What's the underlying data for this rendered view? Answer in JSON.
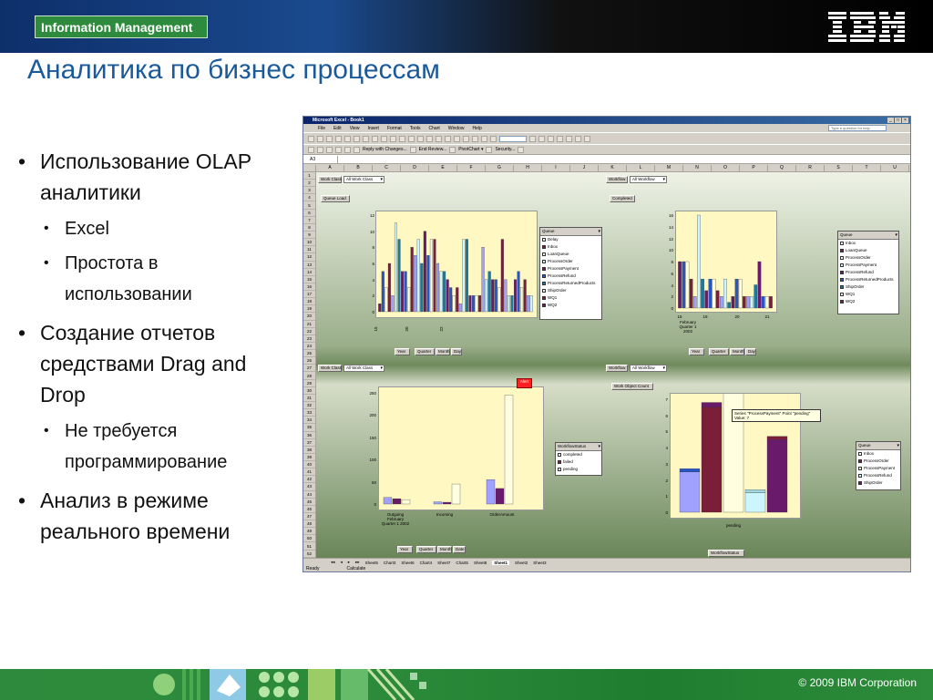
{
  "header": {
    "badge": "Information Management",
    "logo": "IBM",
    "title": "Аналитика по бизнес процессам"
  },
  "bullets": [
    {
      "text": "Использование OLAP аналитики",
      "sub": [
        "Excel",
        "Простота в использовании"
      ]
    },
    {
      "text": "Создание отчетов средствами Drag and Drop",
      "sub": [
        "Не требуется программирование"
      ]
    },
    {
      "text": "Анализ в режиме реального времени",
      "sub": []
    }
  ],
  "excel": {
    "window_title": "Microsoft Excel - Book1",
    "menu": [
      "File",
      "Edit",
      "View",
      "Insert",
      "Format",
      "Tools",
      "Chart",
      "Window",
      "Help"
    ],
    "help_placeholder": "Type a question for help",
    "reviewing_bar": [
      "Reply with Changes...",
      "End Review...",
      "PivotChart ▾",
      "Security..."
    ],
    "name_box": "A3",
    "columns": [
      "A",
      "B",
      "C",
      "D",
      "E",
      "F",
      "G",
      "H",
      "I",
      "J",
      "K",
      "L",
      "M",
      "N",
      "O",
      "P",
      "Q",
      "R",
      "S",
      "T",
      "U"
    ],
    "rows": [
      "1",
      "2",
      "3",
      "4",
      "5",
      "6",
      "7",
      "8",
      "9",
      "10",
      "11",
      "12",
      "13",
      "14",
      "15",
      "16",
      "17",
      "18",
      "19",
      "20",
      "21",
      "22",
      "23",
      "24",
      "25",
      "26",
      "27",
      "28",
      "29",
      "30",
      "31",
      "32",
      "33",
      "34",
      "35",
      "36",
      "37",
      "38",
      "39",
      "40",
      "41",
      "42",
      "43",
      "44",
      "45",
      "46",
      "47",
      "48",
      "49",
      "50",
      "51",
      "52"
    ],
    "sheet_tabs": [
      "Sheet5",
      "Chart3",
      "Sheet6",
      "Chart4",
      "Sheet7",
      "Chart5",
      "Sheet8",
      "Sheet1",
      "Sheet2",
      "Sheet3"
    ],
    "active_tab": "Sheet1",
    "status": [
      "Ready",
      "Calculate"
    ]
  },
  "pivots": {
    "work_class": "Work Class",
    "all_work_class": "All Work Class",
    "workflow": "Workflow",
    "all_workflow": "All Workflow",
    "queue_load": "Queue Load",
    "completed": "Completed",
    "work_object_count": "Work Object Count",
    "date_buttons": [
      "Year",
      "Quarter",
      "Month",
      "Day"
    ],
    "date_buttons2": [
      "Year",
      "Quarter",
      "Month",
      "Date"
    ],
    "workflow_status": "WorkflowStatus"
  },
  "legends": {
    "queue1": {
      "title": "Queue",
      "items": [
        "Delay",
        "Inbox",
        "LoanQueue",
        "ProcessOrder",
        "ProcessPayment",
        "ProcessRefund",
        "ProcessReturnedProducts",
        "ShipOrder",
        "WQ1",
        "WQ2"
      ]
    },
    "queue2": {
      "title": "Queue",
      "items": [
        "Inbox",
        "LoanQueue",
        "ProcessOrder",
        "ProcessPayment",
        "ProcessRefund",
        "ProcessReturnedProducts",
        "ShipOrder",
        "WQ1",
        "WQ2"
      ]
    },
    "wfstatus": {
      "title": "WorkflowStatus",
      "items": [
        "completed",
        "failed",
        "pending"
      ]
    },
    "queue3": {
      "title": "Queue",
      "items": [
        "Inbox",
        "ProcessOrder",
        "ProcessPayment",
        "ProcessRefund",
        "ShipOrder"
      ]
    }
  },
  "colors": {
    "purple": "#6a1a6a",
    "dark_red": "#7a1e3a",
    "blue": "#2855c8",
    "cream": "#ffffe0",
    "lavender": "#a0a0ff",
    "light_cyan": "#ccf5ff",
    "teal": "#1a7aa0",
    "accent_green": "#2e8b3d",
    "title_blue": "#1a5a9a"
  },
  "chart1": {
    "type": "bar",
    "yticks": [
      "12",
      "10",
      "8",
      "6",
      "4",
      "2",
      "0"
    ],
    "ylim": [
      0,
      12
    ],
    "xlabels": [
      "15",
      "20",
      "22"
    ],
    "xsub": "February Quarter 1 2002",
    "bars": [
      1,
      5,
      3,
      6,
      2,
      11,
      9,
      5,
      5,
      3,
      8,
      7,
      9,
      6,
      10,
      7,
      9,
      9,
      6,
      5,
      5,
      4,
      3,
      2,
      3,
      1,
      9,
      9,
      2,
      2,
      2,
      2,
      8,
      4,
      5,
      4,
      4,
      3,
      9,
      4,
      2,
      2,
      4,
      5,
      3,
      4,
      2,
      2
    ]
  },
  "chart2": {
    "type": "bar",
    "yticks": [
      "16",
      "14",
      "12",
      "10",
      "8",
      "6",
      "4",
      "2",
      "0"
    ],
    "ylim": [
      0,
      16
    ],
    "xlabels": [
      "15",
      "19",
      "20",
      "21"
    ],
    "xsub": "February Quarter 1 2002",
    "bars": [
      8,
      8,
      8,
      5,
      2,
      16,
      5,
      3,
      5,
      5,
      3,
      2,
      5,
      1,
      2,
      5,
      5,
      2,
      2,
      2,
      4,
      8,
      2,
      2,
      2
    ]
  },
  "chart3": {
    "type": "bar",
    "yticks": [
      "250",
      "200",
      "150",
      "100",
      "50",
      "0"
    ],
    "ylim": [
      0,
      250
    ],
    "categories": [
      "Outgoing February Quarter 1 2002",
      "Incoming",
      "OrderAmount"
    ],
    "alert": "Alert",
    "groups": [
      [
        15,
        12,
        10
      ],
      [
        5,
        4,
        45
      ],
      [
        55,
        35,
        245
      ]
    ]
  },
  "chart4": {
    "type": "bar",
    "yticks": [
      "7",
      "6",
      "5",
      "4",
      "3",
      "2",
      "1",
      "0"
    ],
    "ylim": [
      0,
      7
    ],
    "category": "pending",
    "stacks": [
      [
        2.5,
        0.2
      ],
      [
        6.5,
        0.3
      ],
      [
        7.5,
        1.5
      ],
      [
        1.2,
        0.2
      ],
      [
        4.5,
        0.2
      ]
    ],
    "tooltip": [
      "Series \"ProcessPayment\" Point \"pending\"",
      "Value: 7"
    ]
  },
  "footer": {
    "copyright": "© 2009  IBM Corporation"
  }
}
